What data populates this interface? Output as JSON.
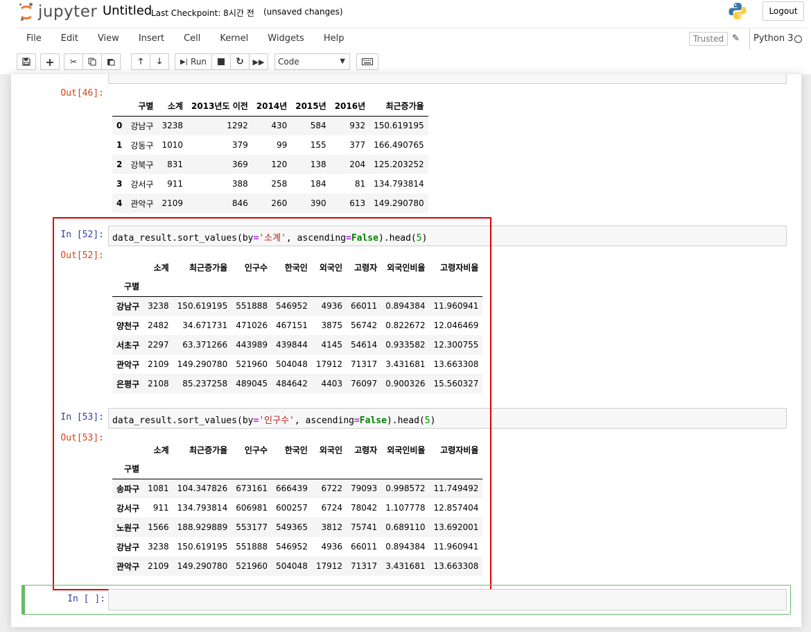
{
  "header": {
    "logo_text": "jupyter",
    "notebook_title": "Untitled",
    "checkpoint": "Last Checkpoint: 8시간 전",
    "autosave_status": "(unsaved changes)",
    "logout_label": "Logout"
  },
  "menubar": {
    "items": [
      "File",
      "Edit",
      "View",
      "Insert",
      "Cell",
      "Kernel",
      "Widgets",
      "Help"
    ],
    "trusted_label": "Trusted",
    "kernel_name": "Python 3"
  },
  "toolbar": {
    "run_label": "Run",
    "cell_type": "Code"
  },
  "cells": {
    "partial_out": {
      "prompt": "Out[46]:",
      "columns": [
        "",
        "구별",
        "소계",
        "2013년도 이전",
        "2014년",
        "2015년",
        "2016년",
        "최근증가율"
      ],
      "rows": [
        [
          "0",
          "강남구",
          "3238",
          "1292",
          "430",
          "584",
          "932",
          "150.619195"
        ],
        [
          "1",
          "강동구",
          "1010",
          "379",
          "99",
          "155",
          "377",
          "166.490765"
        ],
        [
          "2",
          "강북구",
          "831",
          "369",
          "120",
          "138",
          "204",
          "125.203252"
        ],
        [
          "3",
          "강서구",
          "911",
          "388",
          "258",
          "184",
          "81",
          "134.793814"
        ],
        [
          "4",
          "관악구",
          "2109",
          "846",
          "260",
          "390",
          "613",
          "149.290780"
        ]
      ]
    },
    "cell52": {
      "in_prompt": "In [52]:",
      "code_prefix": "data_result.sort_values(by",
      "code_eq1": "=",
      "code_str": "'소계'",
      "code_mid": ", ascending",
      "code_eq2": "=",
      "code_kw": "False",
      "code_head": ").head(",
      "code_num": "5",
      "code_end": ")",
      "out_prompt": "Out[52]:",
      "columns": [
        "소계",
        "최근증가율",
        "인구수",
        "한국인",
        "외국인",
        "고령자",
        "외국인비율",
        "고령자비율"
      ],
      "index_name": "구별",
      "rows": [
        [
          "강남구",
          "3238",
          "150.619195",
          "551888",
          "546952",
          "4936",
          "66011",
          "0.894384",
          "11.960941"
        ],
        [
          "양천구",
          "2482",
          "34.671731",
          "471026",
          "467151",
          "3875",
          "56742",
          "0.822672",
          "12.046469"
        ],
        [
          "서초구",
          "2297",
          "63.371266",
          "443989",
          "439844",
          "4145",
          "54614",
          "0.933582",
          "12.300755"
        ],
        [
          "관악구",
          "2109",
          "149.290780",
          "521960",
          "504048",
          "17912",
          "71317",
          "3.431681",
          "13.663308"
        ],
        [
          "은평구",
          "2108",
          "85.237258",
          "489045",
          "484642",
          "4403",
          "76097",
          "0.900326",
          "15.560327"
        ]
      ]
    },
    "cell53": {
      "in_prompt": "In [53]:",
      "code_prefix": "data_result.sort_values(by",
      "code_eq1": "=",
      "code_str": "'인구수'",
      "code_mid": ", ascending",
      "code_eq2": "=",
      "code_kw": "False",
      "code_head": ").head(",
      "code_num": "5",
      "code_end": ")",
      "out_prompt": "Out[53]:",
      "columns": [
        "소계",
        "최근증가율",
        "인구수",
        "한국인",
        "외국인",
        "고령자",
        "외국인비율",
        "고령자비율"
      ],
      "index_name": "구별",
      "rows": [
        [
          "송파구",
          "1081",
          "104.347826",
          "673161",
          "666439",
          "6722",
          "79093",
          "0.998572",
          "11.749492"
        ],
        [
          "강서구",
          "911",
          "134.793814",
          "606981",
          "600257",
          "6724",
          "78042",
          "1.107778",
          "12.857404"
        ],
        [
          "노원구",
          "1566",
          "188.929889",
          "553177",
          "549365",
          "3812",
          "75741",
          "0.689110",
          "13.692001"
        ],
        [
          "강남구",
          "3238",
          "150.619195",
          "551888",
          "546952",
          "4936",
          "66011",
          "0.894384",
          "11.960941"
        ],
        [
          "관악구",
          "2109",
          "149.290780",
          "521960",
          "504048",
          "17912",
          "71317",
          "3.431681",
          "13.663308"
        ]
      ]
    },
    "empty_cell": {
      "in_prompt": "In [ ]:"
    }
  },
  "colors": {
    "in_prompt": "#303f9f",
    "out_prompt": "#d84315",
    "highlight": "#e00000",
    "selected_border": "#66bb6a",
    "jupyter_orange": "#f37726"
  },
  "icons": [
    "save-icon",
    "add-cell-icon",
    "cut-icon",
    "copy-icon",
    "paste-icon",
    "move-up-icon",
    "move-down-icon",
    "run-icon",
    "stop-icon",
    "restart-icon",
    "fast-forward-icon",
    "keyboard-icon",
    "pencil-icon",
    "python-logo-icon"
  ]
}
